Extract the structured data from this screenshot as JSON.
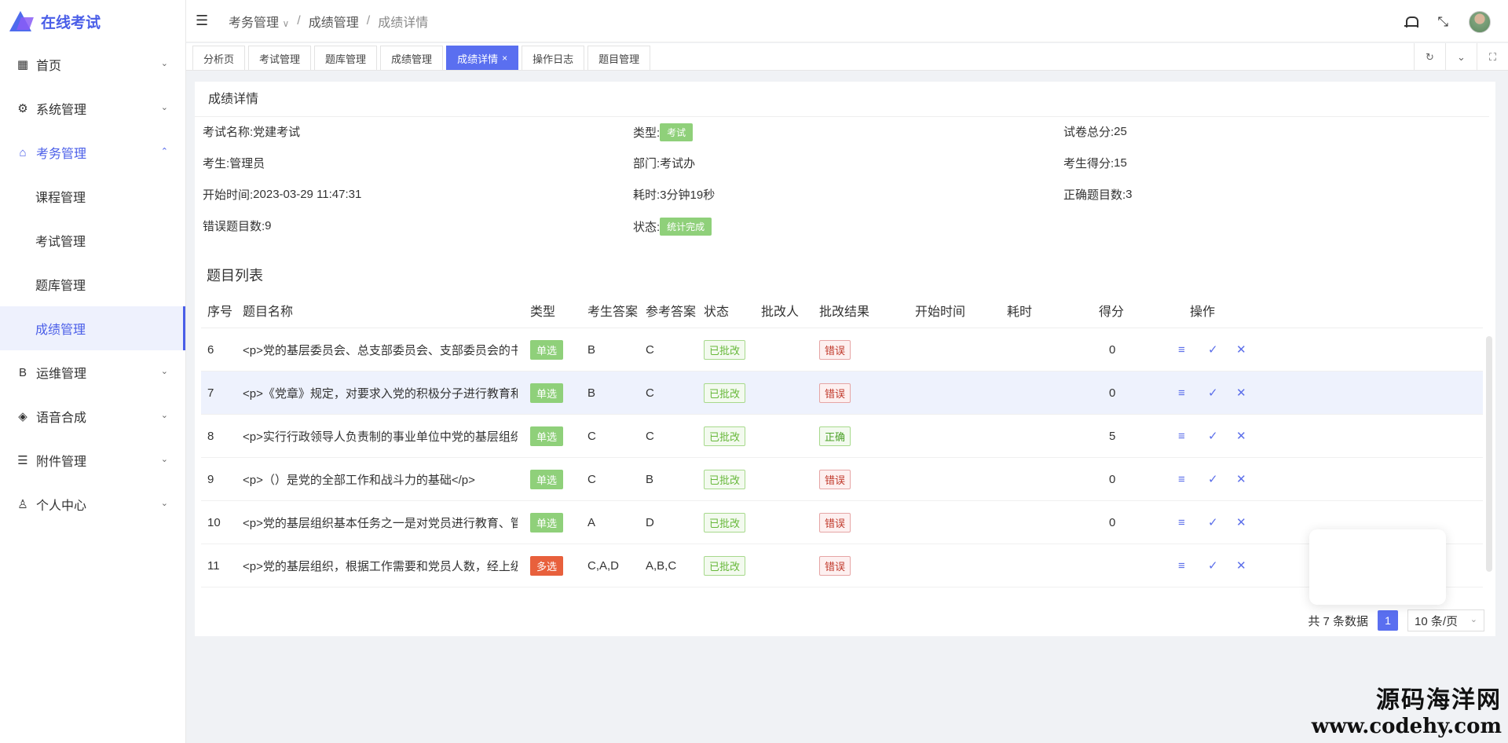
{
  "app": {
    "title": "在线考试"
  },
  "sidebar": {
    "items": [
      {
        "icon": "grid-icon",
        "glyph": "▦",
        "label": "首页",
        "arrow": "⌄",
        "open": false
      },
      {
        "icon": "gear-icon",
        "glyph": "⚙",
        "label": "系统管理",
        "arrow": "⌄",
        "open": false
      },
      {
        "icon": "bank-icon",
        "glyph": "⌂",
        "label": "考务管理",
        "arrow": "⌃",
        "open": true,
        "children": [
          "课程管理",
          "考试管理",
          "题库管理",
          "成绩管理"
        ]
      },
      {
        "icon": "letter-b-icon",
        "glyph": "B",
        "label": "运维管理",
        "arrow": "⌄",
        "open": false
      },
      {
        "icon": "cube-icon",
        "glyph": "◈",
        "label": "语音合成",
        "arrow": "⌄",
        "open": false
      },
      {
        "icon": "file-list-icon",
        "glyph": "☰",
        "label": "附件管理",
        "arrow": "⌄",
        "open": false
      },
      {
        "icon": "user-icon",
        "glyph": "♙",
        "label": "个人中心",
        "arrow": "⌄",
        "open": false
      }
    ]
  },
  "header": {
    "breadcrumb": [
      "考务管理",
      "成绩管理",
      "成绩详情"
    ],
    "breadcrumb_dropdown": "∨",
    "separator": "/"
  },
  "tabs": [
    {
      "label": "分析页",
      "active": false
    },
    {
      "label": "考试管理",
      "active": false
    },
    {
      "label": "题库管理",
      "active": false
    },
    {
      "label": "成绩管理",
      "active": false
    },
    {
      "label": "成绩详情",
      "active": true,
      "close": "×"
    },
    {
      "label": "操作日志",
      "active": false
    },
    {
      "label": "题目管理",
      "active": false
    }
  ],
  "tab_tools": {
    "refresh": "↻",
    "dropdown": "⌄",
    "fullscreen": "⛶"
  },
  "detail": {
    "title": "成绩详情",
    "exam_name_label": "考试名称:",
    "exam_name": "党建考试",
    "type_label": "类型:",
    "type": "考试",
    "total_label": "试卷总分:",
    "total": "25",
    "student_label": "考生:",
    "student": "管理员",
    "dept_label": "部门:",
    "dept": "考试办",
    "score_label": "考生得分:",
    "score": "15",
    "start_label": "开始时间:",
    "start": "2023-03-29 11:47:31",
    "duration_label": "耗时:",
    "duration": "3分钟19秒",
    "correct_label": "正确题目数:",
    "correct": "3",
    "wrong_label": "错误题目数:",
    "wrong": "9",
    "status_label": "状态:",
    "status": "统计完成"
  },
  "question_list": {
    "title": "题目列表",
    "columns": [
      "序号",
      "题目名称",
      "类型",
      "考生答案",
      "参考答案",
      "状态",
      "批改人",
      "批改结果",
      "开始时间",
      "耗时",
      "得分",
      "操作"
    ],
    "rows": [
      {
        "no": "6",
        "name": "<p>党的基层委员会、总支部委员会、支部委员会的书记、...",
        "type": "单选",
        "multi": false,
        "answer": "B",
        "ref": "C",
        "status": "已批改",
        "grader": "",
        "result": "错误",
        "ok": false,
        "start": "",
        "time": "",
        "score": "0"
      },
      {
        "no": "7",
        "name": "<p>《党章》规定，对要求入党的积极分子进行教育和培养...",
        "type": "单选",
        "multi": false,
        "answer": "B",
        "ref": "C",
        "status": "已批改",
        "grader": "",
        "result": "错误",
        "ok": false,
        "start": "",
        "time": "",
        "score": "0"
      },
      {
        "no": "8",
        "name": "<p>实行行政领导人负责制的事业单位中党的基层组织，发...",
        "type": "单选",
        "multi": false,
        "answer": "C",
        "ref": "C",
        "status": "已批改",
        "grader": "",
        "result": "正确",
        "ok": true,
        "start": "",
        "time": "",
        "score": "5"
      },
      {
        "no": "9",
        "name": "<p>（）是党的全部工作和战斗力的基础</p>",
        "type": "单选",
        "multi": false,
        "answer": "C",
        "ref": "B",
        "status": "已批改",
        "grader": "",
        "result": "错误",
        "ok": false,
        "start": "",
        "time": "",
        "score": "0"
      },
      {
        "no": "10",
        "name": "<p>党的基层组织基本任务之一是对党员进行教育、管理、...",
        "type": "单选",
        "multi": false,
        "answer": "A",
        "ref": "D",
        "status": "已批改",
        "grader": "",
        "result": "错误",
        "ok": false,
        "start": "",
        "time": "",
        "score": "0"
      },
      {
        "no": "11",
        "name": "<p>党的基层组织，根据工作需要和党员人数，经上级党组...",
        "type": "多选",
        "multi": true,
        "answer": "C,A,D",
        "ref": "A,B,C",
        "status": "已批改",
        "grader": "",
        "result": "错误",
        "ok": false,
        "start": "",
        "time": "",
        "score": ""
      }
    ],
    "row_actions": {
      "detail": "≡",
      "approve": "✓",
      "reject": "✕"
    }
  },
  "pagination": {
    "total_text": "共 7 条数据",
    "current": "1",
    "page_size": "10 条/页",
    "arrow": "⌄"
  },
  "watermark": {
    "line1": "源码海洋网",
    "line2": "www.codehy.com"
  }
}
